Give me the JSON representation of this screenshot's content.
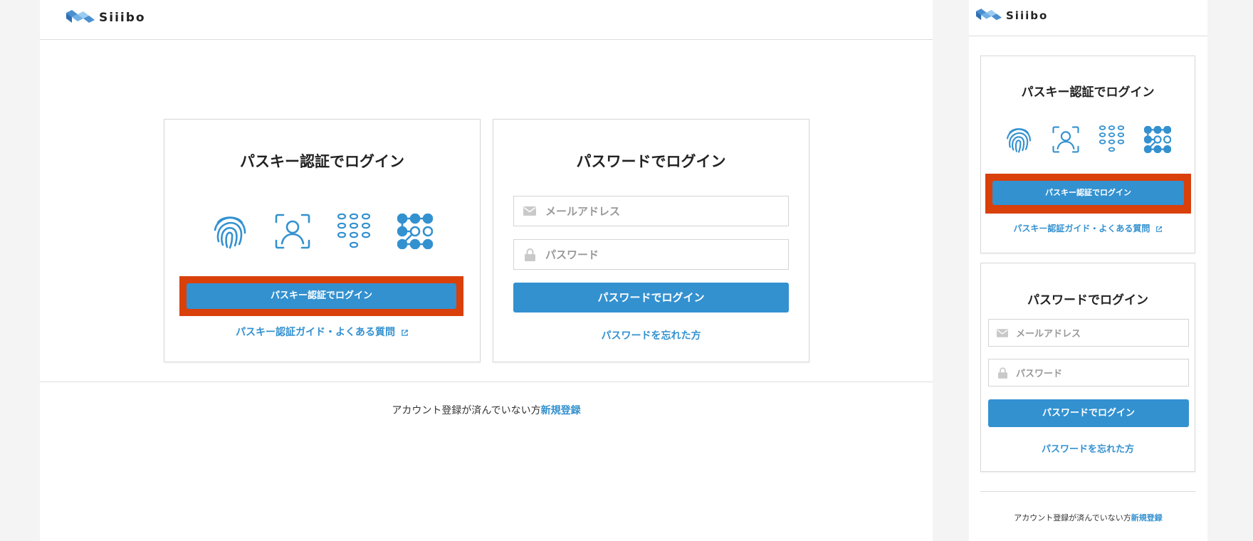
{
  "brand": {
    "name_prefix": "S",
    "name_rest": "iiibo",
    "logo_text": "Siiibo",
    "color": "#3391d0"
  },
  "passkey": {
    "title": "パスキー認証でログイン",
    "icons": [
      "fingerprint-icon",
      "face-id-icon",
      "pin-keypad-icon",
      "pattern-lock-icon"
    ],
    "button_label": "パスキー認証でログイン",
    "guide_link": "パスキー認証ガイド・よくある質問"
  },
  "password": {
    "title": "パスワードでログイン",
    "email_placeholder": "メールアドレス",
    "password_placeholder": "パスワード",
    "button_label": "パスワードでログイン",
    "forgot_link": "パスワードを忘れた方"
  },
  "footer": {
    "text": "アカウント登録が済んでいない方",
    "signup_link": "新規登録"
  },
  "colors": {
    "accent": "#3391d0",
    "highlight": "#d9400a",
    "border": "#d8d8d8"
  }
}
